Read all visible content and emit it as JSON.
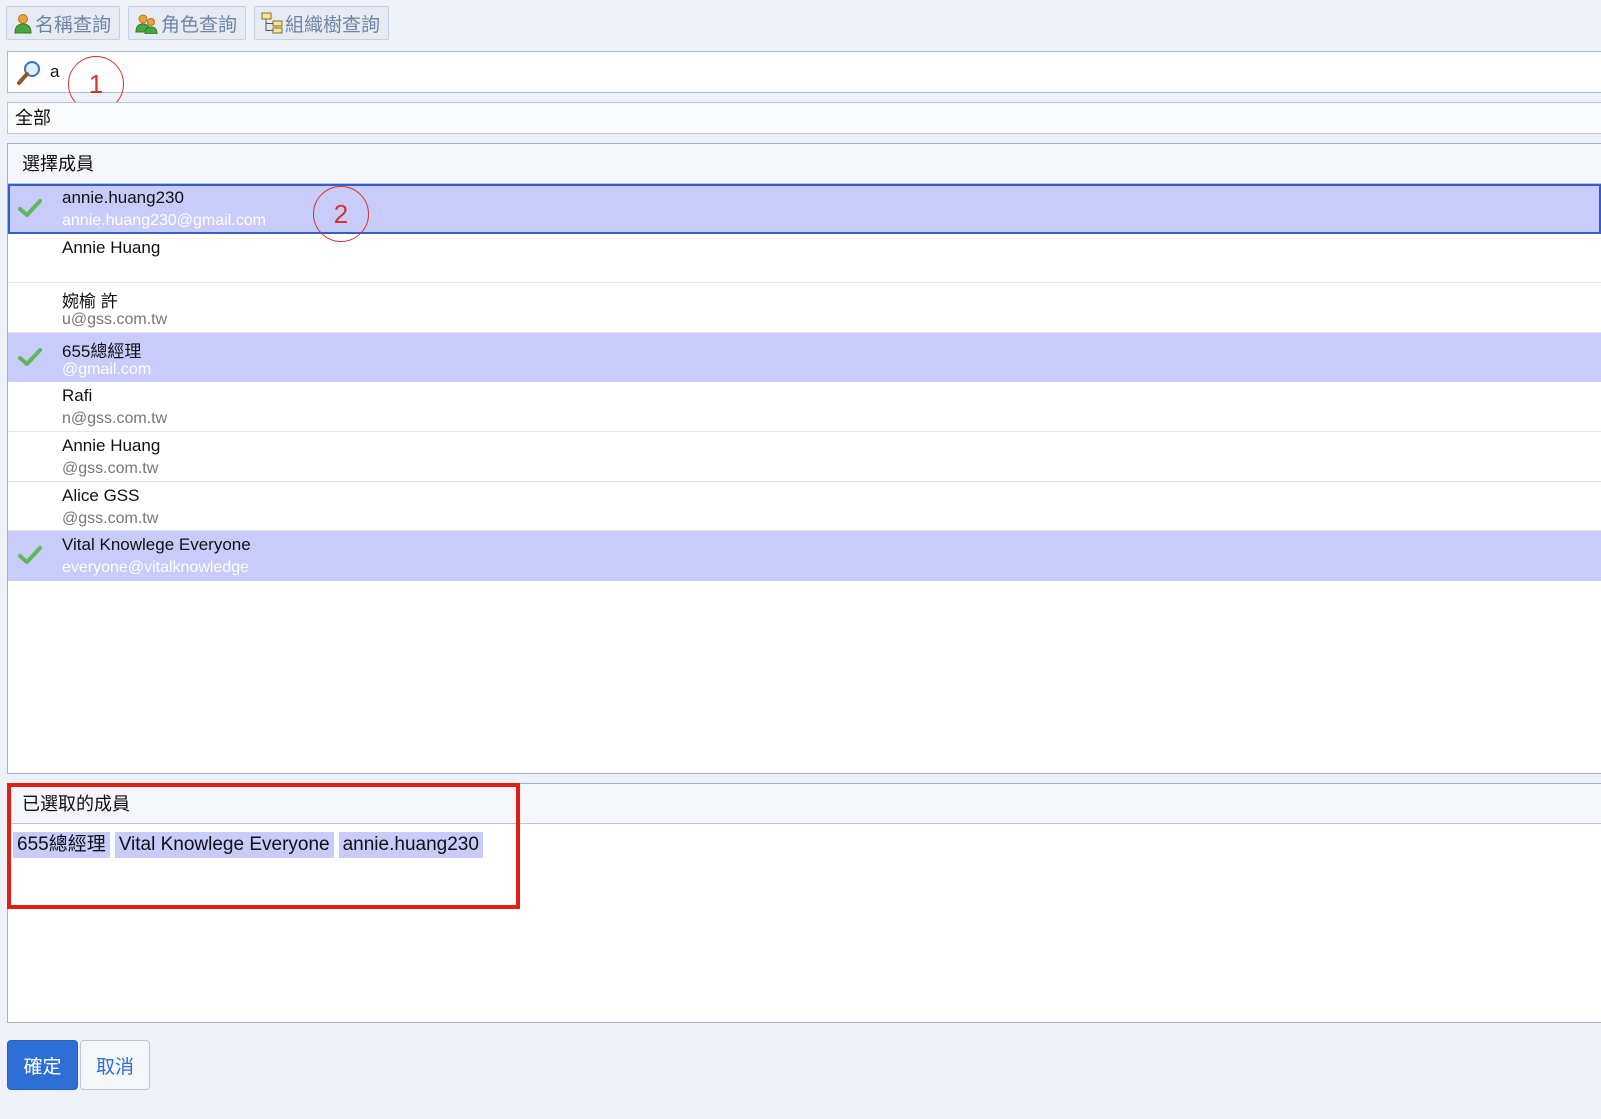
{
  "tabs": [
    {
      "label": "名稱查詢",
      "icon": "user-icon"
    },
    {
      "label": "角色查詢",
      "icon": "group-icon"
    },
    {
      "label": "組織樹查詢",
      "icon": "org-tree-icon"
    }
  ],
  "search": {
    "value": "a",
    "icon": "search-icon"
  },
  "annotations": {
    "marker_1": "1",
    "marker_2": "2"
  },
  "filter": {
    "label": "全部"
  },
  "member_panel": {
    "title": "選擇成員",
    "members": [
      {
        "name": "annie.huang230",
        "email": "annie.huang230@gmail.com",
        "selected": true
      },
      {
        "name": "Annie Huang",
        "email": "",
        "selected": false
      },
      {
        "name": "婉榆 許",
        "email": "u@gss.com.tw",
        "selected": false
      },
      {
        "name": "655總經理",
        "email": "@gmail.com",
        "selected": true
      },
      {
        "name": "Rafi",
        "email": "n@gss.com.tw",
        "selected": false
      },
      {
        "name": "Annie Huang",
        "email": "@gss.com.tw",
        "selected": false
      },
      {
        "name": "Alice GSS",
        "email": "@gss.com.tw",
        "selected": false
      },
      {
        "name": "Vital Knowlege Everyone",
        "email": "everyone@vitalknowledge",
        "selected": true
      }
    ]
  },
  "selected_panel": {
    "title": "已選取的成員",
    "chips": [
      "655總經理",
      "Vital Knowlege Everyone",
      "annie.huang230"
    ]
  },
  "buttons": {
    "confirm": "確定",
    "cancel": "取消"
  },
  "colors": {
    "selected_row": "#c9cbfb",
    "primary_button": "#2e6fd6",
    "highlight_box": "#e41d12",
    "check": "#5cb85c",
    "page_bg": "#eef2f8"
  }
}
